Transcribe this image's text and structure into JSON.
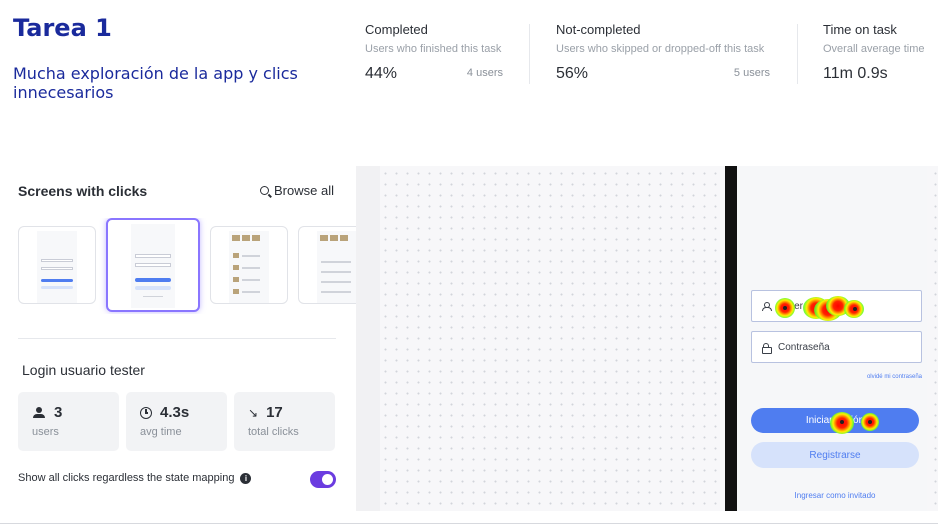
{
  "header": {
    "title": "Tarea 1",
    "subtitle": "Mucha exploración de la app y clics innecesarios"
  },
  "metrics": {
    "completed": {
      "label": "Completed",
      "desc": "Users who finished this task",
      "value": "44%",
      "users": "4 users"
    },
    "not_completed": {
      "label": "Not-completed",
      "desc": "Users who skipped or dropped-off this task",
      "value": "56%",
      "users": "5 users"
    },
    "time_on_task": {
      "label": "Time on task",
      "desc": "Overall average time",
      "value": "11m 0.9s"
    }
  },
  "screens": {
    "title": "Screens with clicks",
    "browse_all": "Browse all",
    "browse_icon": "search-icon"
  },
  "screen_detail": {
    "title": "Login usuario tester",
    "stats": [
      {
        "icon": "users-icon",
        "value": "3",
        "label": "users"
      },
      {
        "icon": "clock-icon",
        "value": "4.3s",
        "label": "avg time"
      },
      {
        "icon": "cursor-click-icon",
        "value": "17",
        "label": "total clicks"
      }
    ],
    "show_all_label": "Show all clicks regardless the state mapping",
    "toggle_on": true
  },
  "phone": {
    "username_placeholder": "tester",
    "password_placeholder": "Contraseña",
    "forgot_password": "olvidé mi contraseña",
    "login_button": "Iniciar sesión",
    "register_button": "Registrarse",
    "guest_link": "Ingresar como invitado"
  },
  "colors": {
    "title_blue": "#1a2a9c",
    "accent_purple": "#6b3ce0",
    "button_blue": "#4f7df0",
    "button_light": "#d6e2fb"
  }
}
